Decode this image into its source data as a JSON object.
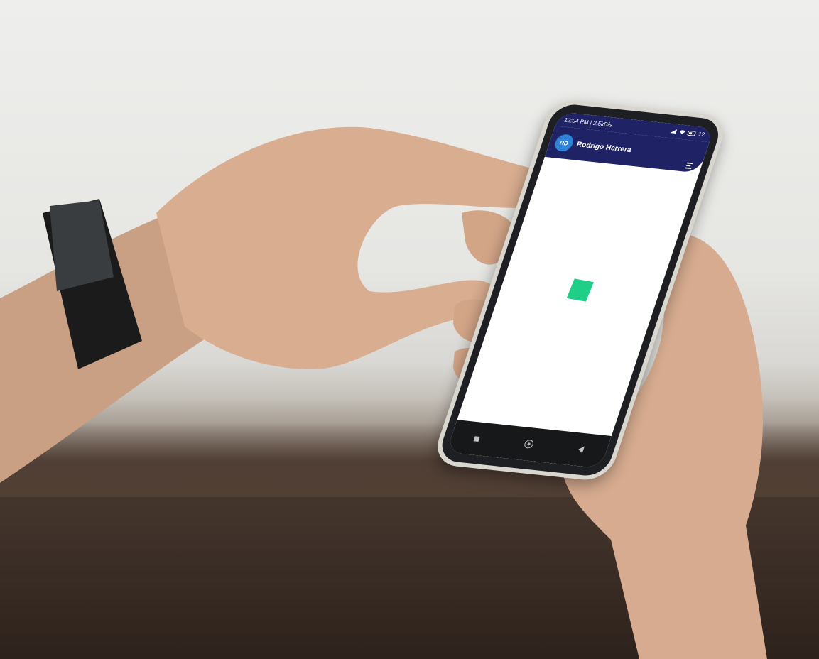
{
  "status_bar": {
    "left": "12:04 PM | 2.5kB/s",
    "right": "12"
  },
  "app_bar": {
    "avatar_initials": "RD",
    "user_name": "Rodrigo Herrera",
    "menu_icon": "menu-lines-icon"
  },
  "content": {
    "loader_color": "#1fce87",
    "loader_icon": "square-loader-icon"
  },
  "nav_bar": {
    "recents_icon": "square-icon",
    "home_icon": "circle-home-icon",
    "back_icon": "triangle-back-icon"
  },
  "colors": {
    "app_bar": "#1f2366",
    "avatar": "#2f84d9",
    "loader": "#1fce87"
  }
}
